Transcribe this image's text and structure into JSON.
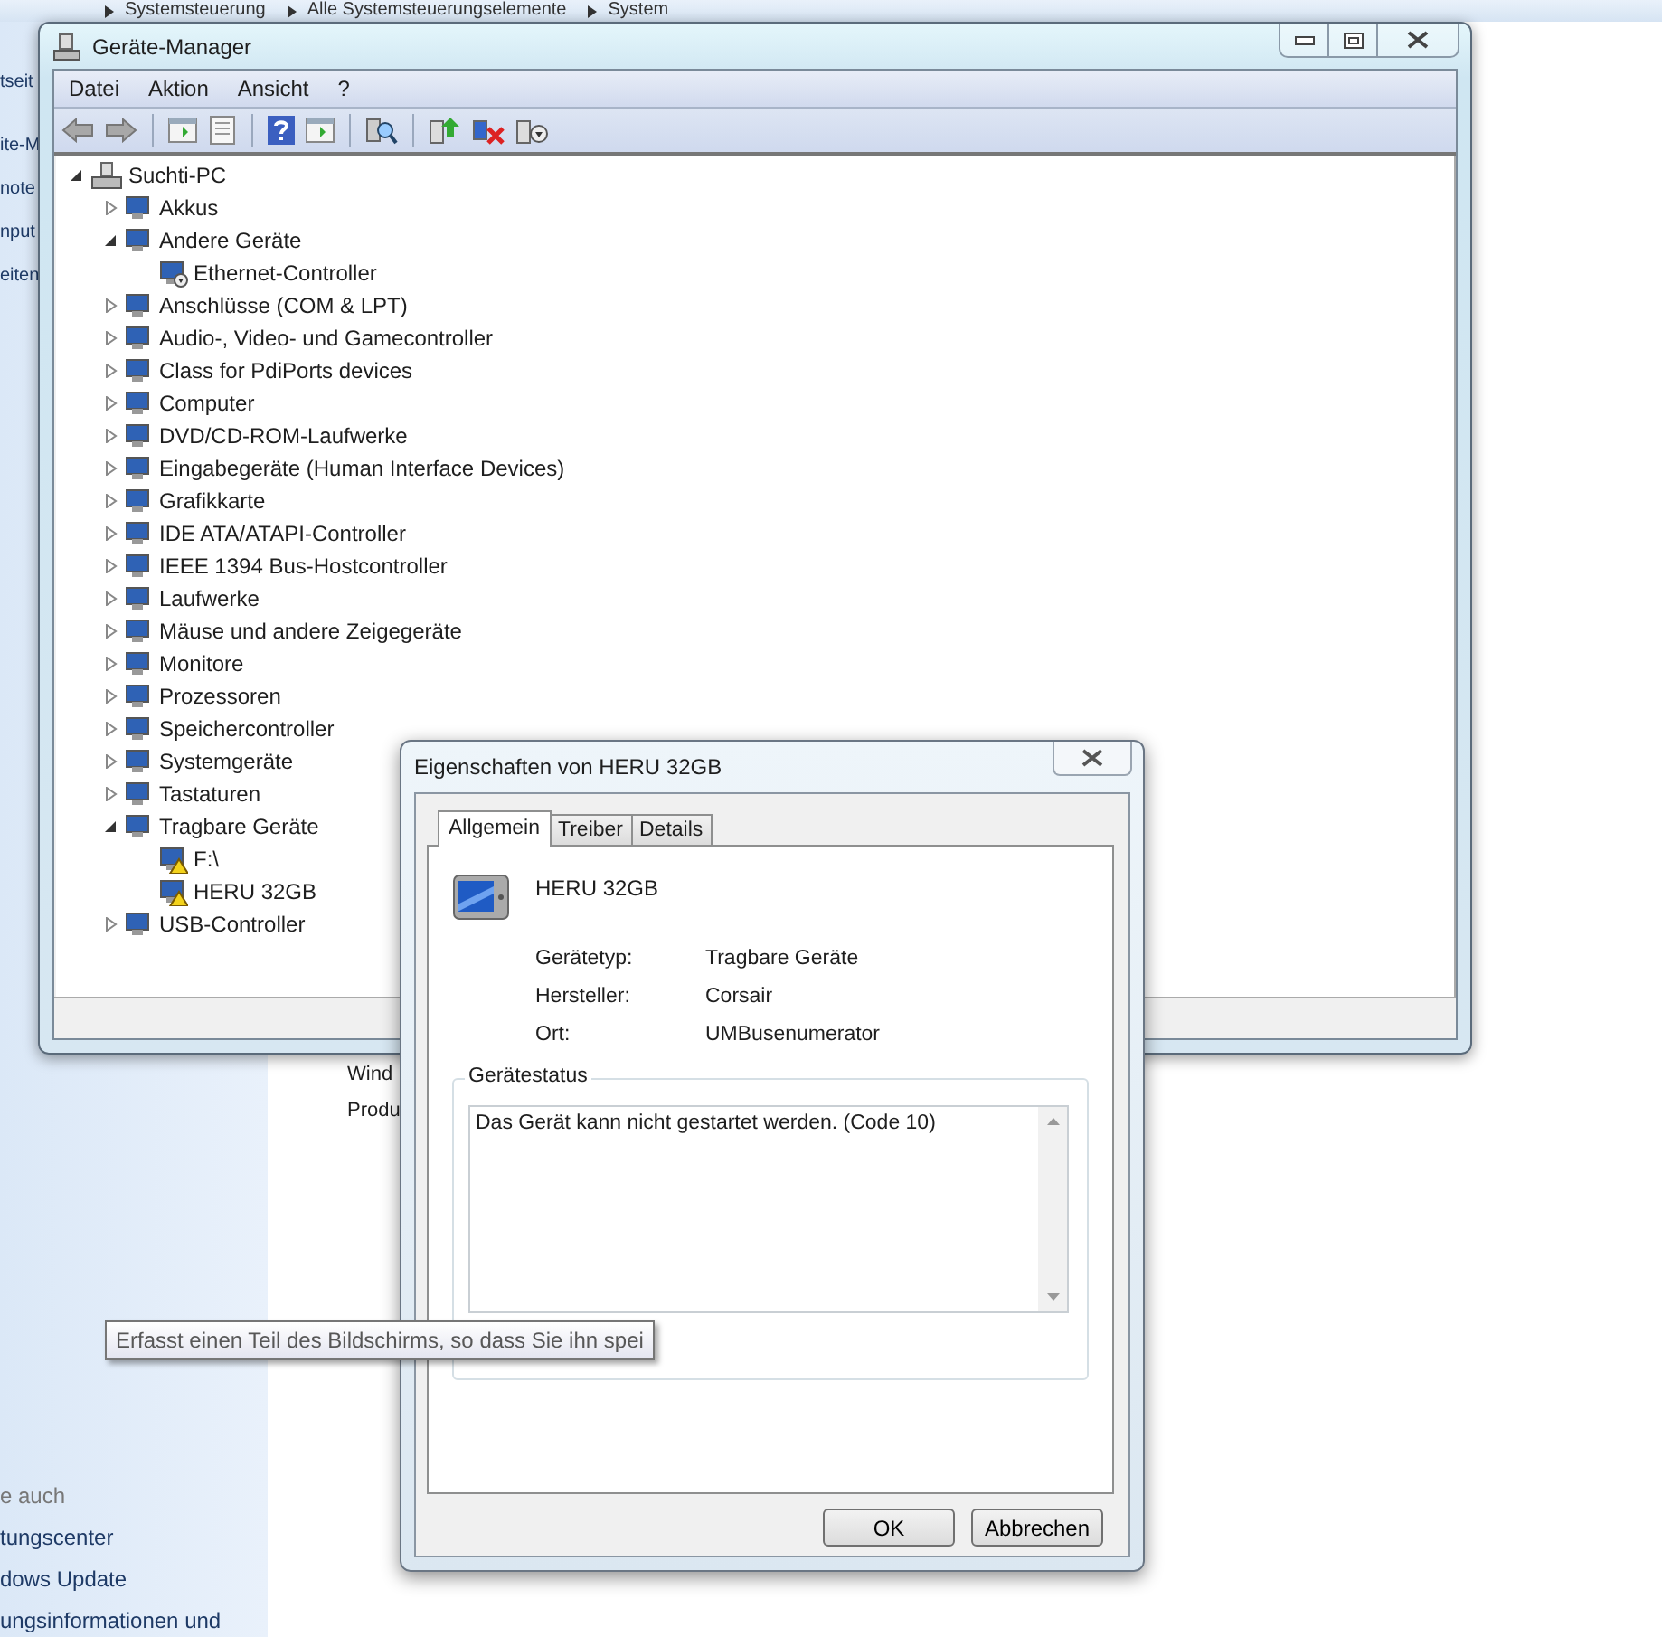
{
  "background": {
    "breadcrumb": [
      "Systemsteuerung",
      "Alle Systemsteuerungselemente",
      "System"
    ],
    "sidebar_links": [
      "tseit",
      "ite-M",
      "note",
      "nput",
      "eiten"
    ],
    "see_also": {
      "heading": "e auch",
      "links": [
        "tungscenter",
        "dows Update",
        "ungsinformationen und"
      ]
    },
    "content_labels": [
      "Wind",
      "Produ"
    ]
  },
  "device_manager": {
    "title": "Geräte-Manager",
    "menu": [
      "Datei",
      "Aktion",
      "Ansicht",
      "?"
    ],
    "tree": {
      "label": "Suchti-PC",
      "expanded": true,
      "children": [
        {
          "label": "Akkus",
          "expanded": false
        },
        {
          "label": "Andere Geräte",
          "expanded": true,
          "children": [
            {
              "label": "Ethernet-Controller",
              "disabled": true
            }
          ]
        },
        {
          "label": "Anschlüsse (COM & LPT)",
          "expanded": false
        },
        {
          "label": "Audio-, Video- und Gamecontroller",
          "expanded": false
        },
        {
          "label": "Class for PdiPorts devices",
          "expanded": false
        },
        {
          "label": "Computer",
          "expanded": false
        },
        {
          "label": "DVD/CD-ROM-Laufwerke",
          "expanded": false
        },
        {
          "label": "Eingabegeräte (Human Interface Devices)",
          "expanded": false
        },
        {
          "label": "Grafikkarte",
          "expanded": false
        },
        {
          "label": "IDE ATA/ATAPI-Controller",
          "expanded": false
        },
        {
          "label": "IEEE 1394 Bus-Hostcontroller",
          "expanded": false
        },
        {
          "label": "Laufwerke",
          "expanded": false
        },
        {
          "label": "Mäuse und andere Zeigegeräte",
          "expanded": false
        },
        {
          "label": "Monitore",
          "expanded": false
        },
        {
          "label": "Prozessoren",
          "expanded": false
        },
        {
          "label": "Speichercontroller",
          "expanded": false
        },
        {
          "label": "Systemgeräte",
          "expanded": false
        },
        {
          "label": "Tastaturen",
          "expanded": false
        },
        {
          "label": "Tragbare Geräte",
          "expanded": true,
          "children": [
            {
              "label": "F:\\",
              "warning": true
            },
            {
              "label": "HERU 32GB",
              "warning": true
            }
          ]
        },
        {
          "label": "USB-Controller",
          "expanded": false
        }
      ]
    }
  },
  "properties_dialog": {
    "title": "Eigenschaften von HERU 32GB",
    "tabs": [
      {
        "label": "Allgemein",
        "selected": true
      },
      {
        "label": "Treiber",
        "selected": false
      },
      {
        "label": "Details",
        "selected": false
      }
    ],
    "device_name": "HERU 32GB",
    "fields": [
      {
        "label": "Gerätetyp:",
        "value": "Tragbare Geräte"
      },
      {
        "label": "Hersteller:",
        "value": "Corsair"
      },
      {
        "label": "Ort:",
        "value": "UMBusenumerator"
      }
    ],
    "status_group": {
      "title": "Gerätestatus",
      "text": "Das Gerät kann nicht gestartet werden. (Code 10)"
    },
    "buttons": [
      "OK",
      "Abbrechen"
    ]
  },
  "tooltip": {
    "text": "Erfasst einen Teil des Bildschirms, so dass Sie ihn spei"
  }
}
